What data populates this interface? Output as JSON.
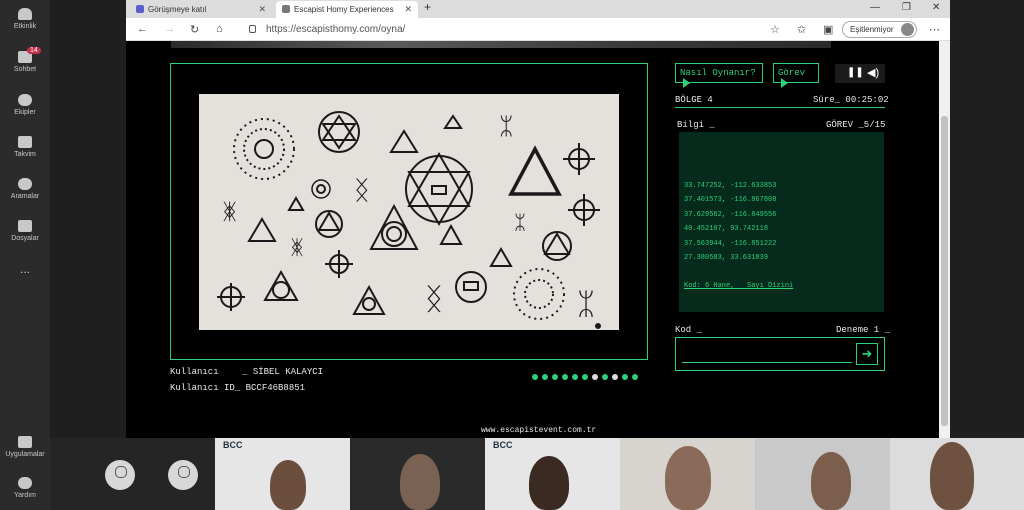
{
  "teams_rail": {
    "items": [
      {
        "label": "Etkinlik",
        "icon": "bell-icon"
      },
      {
        "label": "Sohbet",
        "icon": "chat-icon",
        "badge": "14"
      },
      {
        "label": "Ekipler",
        "icon": "teams-icon"
      },
      {
        "label": "Takvim",
        "icon": "calendar-icon"
      },
      {
        "label": "Aramalar",
        "icon": "phone-icon"
      },
      {
        "label": "Dosyalar",
        "icon": "file-icon"
      },
      {
        "label": "...",
        "icon": "more-icon"
      }
    ],
    "bottom": [
      {
        "label": "Uygulamalar",
        "icon": "apps-icon"
      },
      {
        "label": "Yardım",
        "icon": "help-icon"
      }
    ]
  },
  "browser": {
    "tabs": [
      {
        "title": "Görüşmeye katıl",
        "active": false
      },
      {
        "title": "Escapist Homy Experiences",
        "active": true
      }
    ],
    "new_tab": "+",
    "url": "https://escapisthomy.com/oyna/",
    "profile_label": "Eşitlenmiyor"
  },
  "game": {
    "user_label": "Kullanıcı",
    "user_value": "_ SİBEL KALAYCI",
    "user_id_label": "Kullanıcı ID_",
    "user_id_value": "BCCF46B8851",
    "progress_dots": [
      true,
      true,
      true,
      true,
      true,
      true,
      false,
      true,
      false,
      true,
      true
    ],
    "how_to_play": "Nasıl Oynanır?",
    "task_button": "Görev",
    "region": "BÖLGE 4",
    "time_label": "Süre_",
    "time_value": "00:25:02",
    "info_label": "Bilgi _",
    "task_counter": "GÖREV _5/15",
    "coordinates": [
      "33.747252, -112.633853",
      "37.401573, -116.867808",
      "37.629562, -116.849556",
      "40.452107, 93.742118",
      "37.563944, -116.851222",
      "27.380583, 33.631839"
    ],
    "hint": "Kod: 6 Hane,   Sayı Dizini",
    "code_label": "Kod _",
    "attempt_label": "Deneme 1 _",
    "submit_icon": "arrow-right-icon",
    "footer_url": "www.escapistevent.com.tr"
  },
  "meeting": {
    "tiles": [
      {
        "kind": "avatar"
      },
      {
        "kind": "avatar"
      },
      {
        "kind": "video",
        "logo": "BCC"
      },
      {
        "kind": "video"
      },
      {
        "kind": "video",
        "logo": "BCC"
      },
      {
        "kind": "video"
      },
      {
        "kind": "video"
      },
      {
        "kind": "video"
      }
    ]
  },
  "colors": {
    "accent": "#2cd17a",
    "panel": "#062a1c"
  }
}
